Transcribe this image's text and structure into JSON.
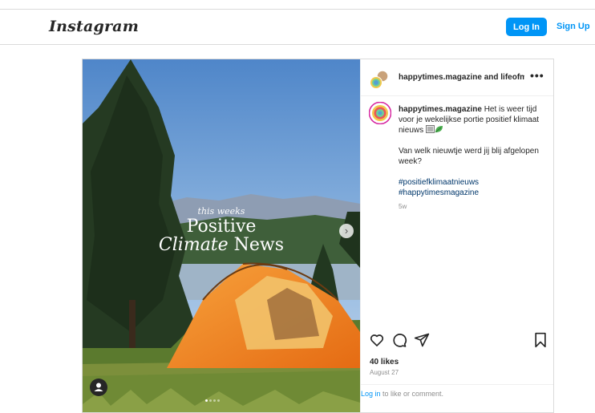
{
  "header": {
    "logo_text": "Instagram",
    "login_label": "Log In",
    "signup_label": "Sign Up"
  },
  "post": {
    "owner": "happytimes.magazine",
    "owner_suffix": " and lifeofma",
    "more_label": "•••",
    "media_overlay": {
      "line1": "this weeks",
      "line2": "Positive",
      "line3_italic": "Climate",
      "line3_rest": " News"
    },
    "next_arrow": "›",
    "caption": {
      "username": "happytimes.magazine",
      "text": " Het is weer tijd voor je wekelijkse portie positief klimaat nieuws ",
      "paragraph2": "Van welk nieuwtje werd jij blij afgelopen week?",
      "hashtags": [
        "#positiefklimaatnieuws",
        "#happytimesmagazine"
      ],
      "age": "5w"
    },
    "likes": "40 likes",
    "date": "August 27",
    "login_prompt": {
      "link": "Log in",
      "text": " to like or comment."
    }
  },
  "colors": {
    "accent": "#0095f6",
    "hashtag": "#00376b",
    "muted": "#8e8e8e"
  },
  "icons": {
    "like": "heart-icon",
    "comment": "comment-icon",
    "share": "paper-plane-icon",
    "save": "bookmark-icon",
    "more": "more-dots-icon"
  }
}
